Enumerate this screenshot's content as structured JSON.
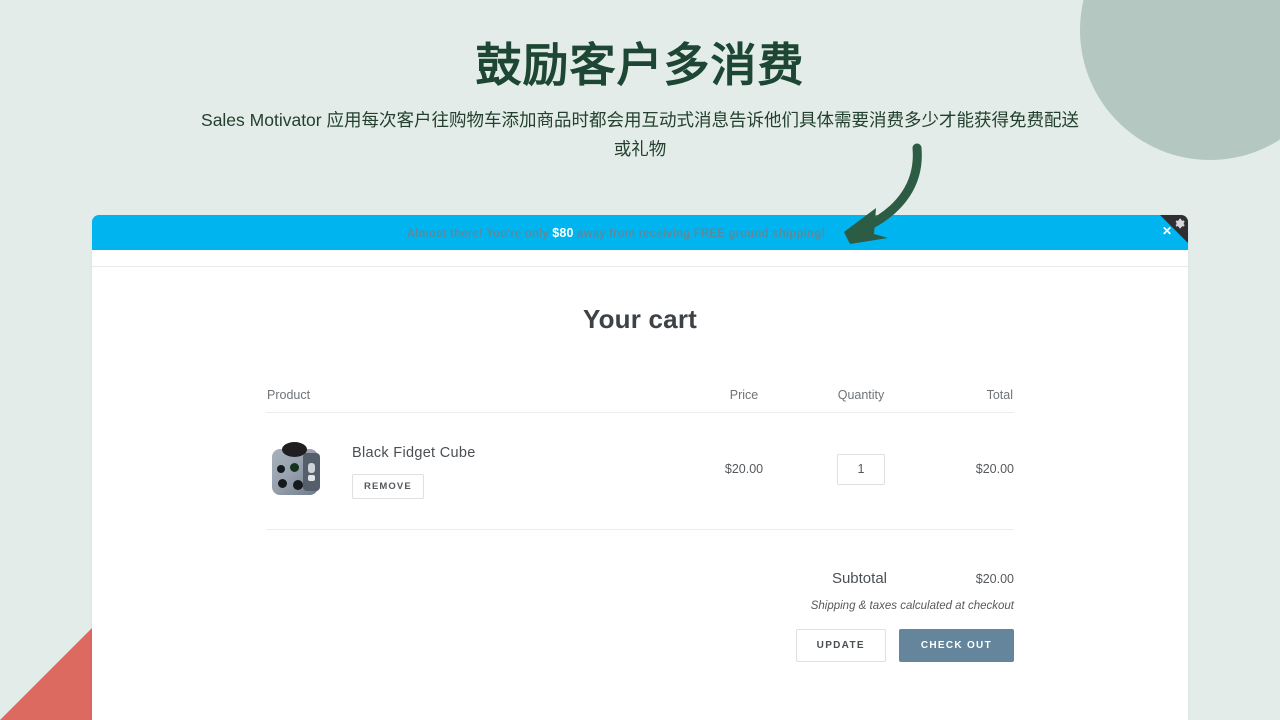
{
  "header": {
    "title": "鼓励客户多消费",
    "subtitle": "Sales Motivator 应用每次客户往购物车添加商品时都会用互动式消息告诉他们具体需要消费多少才能获得免费配送或礼物"
  },
  "promo_banner": {
    "text_before": "Almost there! You're only ",
    "amount": "$80",
    "text_after": " away from receiving FREE ground shipping!",
    "close_label": "✕",
    "background_color": "#00b4f0",
    "text_color": "#5b8a9c",
    "amount_color": "#ffffff",
    "corner_color": "#2f2f33"
  },
  "cart": {
    "title": "Your cart",
    "columns": {
      "product": "Product",
      "price": "Price",
      "quantity": "Quantity",
      "total": "Total"
    },
    "items": [
      {
        "name": "Black Fidget Cube",
        "remove_label": "REMOVE",
        "price": "$20.00",
        "quantity": "1",
        "total": "$20.00"
      }
    ],
    "subtotal_label": "Subtotal",
    "subtotal_value": "$20.00",
    "shipping_note": "Shipping & taxes calculated at checkout",
    "update_label": "UPDATE",
    "checkout_label": "CHECK OUT",
    "checkout_color": "#64859b"
  },
  "theme": {
    "background": "#e3ece8",
    "title_green": "#1d4734",
    "circle_sage": "#b4c8c1",
    "triangle_red": "#dd6a61",
    "arrow_green": "#2c5c44"
  }
}
